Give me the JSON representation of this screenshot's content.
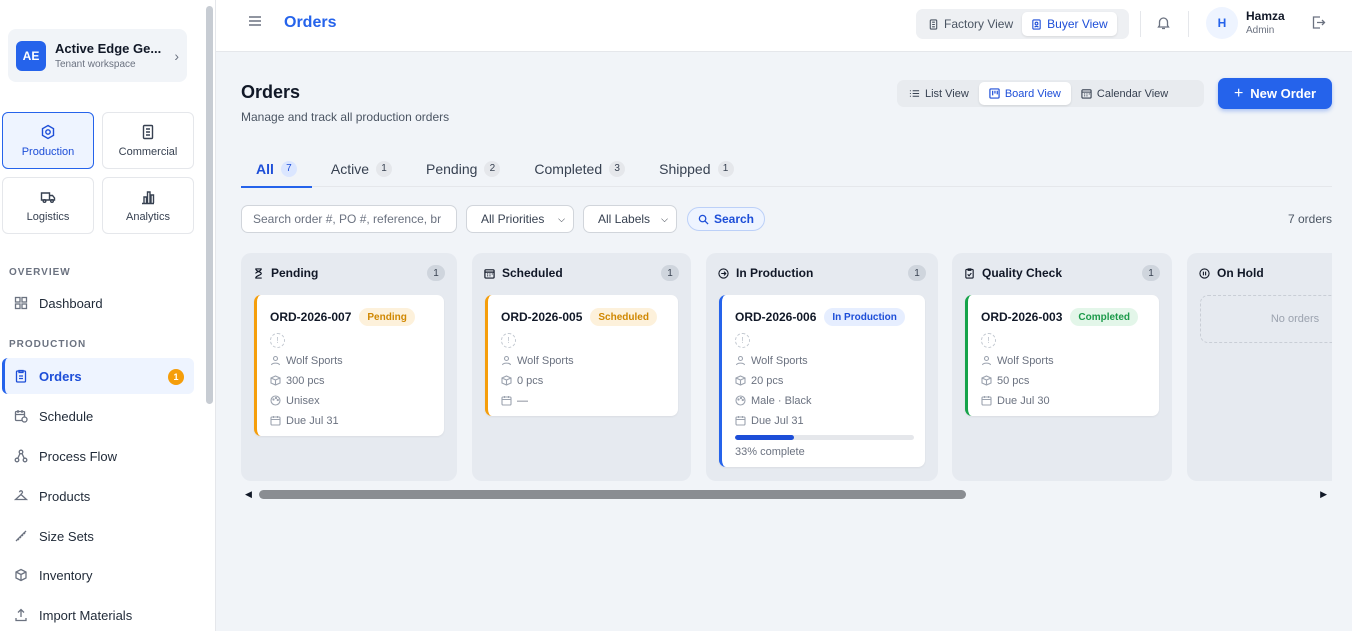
{
  "tenant": {
    "initials": "AE",
    "name": "Active Edge Ge...",
    "subtitle": "Tenant workspace"
  },
  "modules": [
    {
      "label": "Production",
      "icon": "hexagon-icon",
      "active": true
    },
    {
      "label": "Commercial",
      "icon": "building-icon",
      "active": false
    },
    {
      "label": "Logistics",
      "icon": "truck-icon",
      "active": false
    },
    {
      "label": "Analytics",
      "icon": "bar-chart-icon",
      "active": false
    }
  ],
  "sidebar": {
    "overview_label": "OVERVIEW",
    "production_label": "PRODUCTION",
    "overview_items": [
      {
        "label": "Dashboard",
        "icon": "dashboard-icon"
      }
    ],
    "production_items": [
      {
        "label": "Orders",
        "icon": "clipboard-icon",
        "active": true,
        "badge": "1"
      },
      {
        "label": "Schedule",
        "icon": "calendar-clock-icon"
      },
      {
        "label": "Process Flow",
        "icon": "workflow-icon"
      },
      {
        "label": "Products",
        "icon": "hanger-icon"
      },
      {
        "label": "Size Sets",
        "icon": "ruler-icon"
      },
      {
        "label": "Inventory",
        "icon": "box-icon"
      },
      {
        "label": "Import Materials",
        "icon": "upload-icon"
      }
    ]
  },
  "topbar": {
    "title": "Orders",
    "views": [
      {
        "label": "Factory View",
        "icon": "building-icon",
        "active": false
      },
      {
        "label": "Buyer View",
        "icon": "badge-icon",
        "active": true
      }
    ],
    "user": {
      "initial": "H",
      "name": "Hamza",
      "role": "Admin"
    }
  },
  "page": {
    "title": "Orders",
    "subtitle": "Manage and track all production orders",
    "layouts": [
      {
        "label": "List View",
        "icon": "list-icon",
        "active": false
      },
      {
        "label": "Board View",
        "icon": "kanban-icon",
        "active": true
      },
      {
        "label": "Calendar View",
        "icon": "calendar-icon",
        "active": false
      }
    ],
    "new_order_label": "New Order"
  },
  "tabs": [
    {
      "label": "All",
      "count": "7",
      "active": true
    },
    {
      "label": "Active",
      "count": "1"
    },
    {
      "label": "Pending",
      "count": "2"
    },
    {
      "label": "Completed",
      "count": "3"
    },
    {
      "label": "Shipped",
      "count": "1"
    }
  ],
  "filters": {
    "search_placeholder": "Search order #, PO #, reference, br",
    "priority": "All Priorities",
    "labels": "All Labels",
    "search_label": "Search",
    "order_count": "7 orders"
  },
  "board": {
    "columns": [
      {
        "title": "Pending",
        "icon": "hourglass-icon",
        "count": "1",
        "card": {
          "id": "ORD-2026-007",
          "status": "Pending",
          "buyer": "Wolf Sports",
          "qty": "300 pcs",
          "meta": "Unisex",
          "due": "Due Jul 31"
        }
      },
      {
        "title": "Scheduled",
        "icon": "calendar-icon",
        "count": "1",
        "card": {
          "id": "ORD-2026-005",
          "status": "Scheduled",
          "buyer": "Wolf Sports",
          "qty": "0 pcs",
          "due": "—"
        }
      },
      {
        "title": "In Production",
        "icon": "arrow-circle-icon",
        "count": "1",
        "card": {
          "id": "ORD-2026-006",
          "status": "In Production",
          "buyer": "Wolf Sports",
          "qty": "20 pcs",
          "meta": "Male · Black",
          "due": "Due Jul 31",
          "progress": 0.33,
          "progress_label": "33% complete"
        }
      },
      {
        "title": "Quality Check",
        "icon": "clipboard-check-icon",
        "count": "1",
        "card": {
          "id": "ORD-2026-003",
          "status": "Completed",
          "buyer": "Wolf Sports",
          "qty": "50 pcs",
          "due": "Due Jul 30"
        }
      },
      {
        "title": "On Hold",
        "icon": "pause-circle-icon",
        "empty_label": "No orders"
      }
    ]
  },
  "colors": {
    "accent": "#2563eb",
    "pending": "#f59e0b",
    "completed": "#16a34a"
  }
}
